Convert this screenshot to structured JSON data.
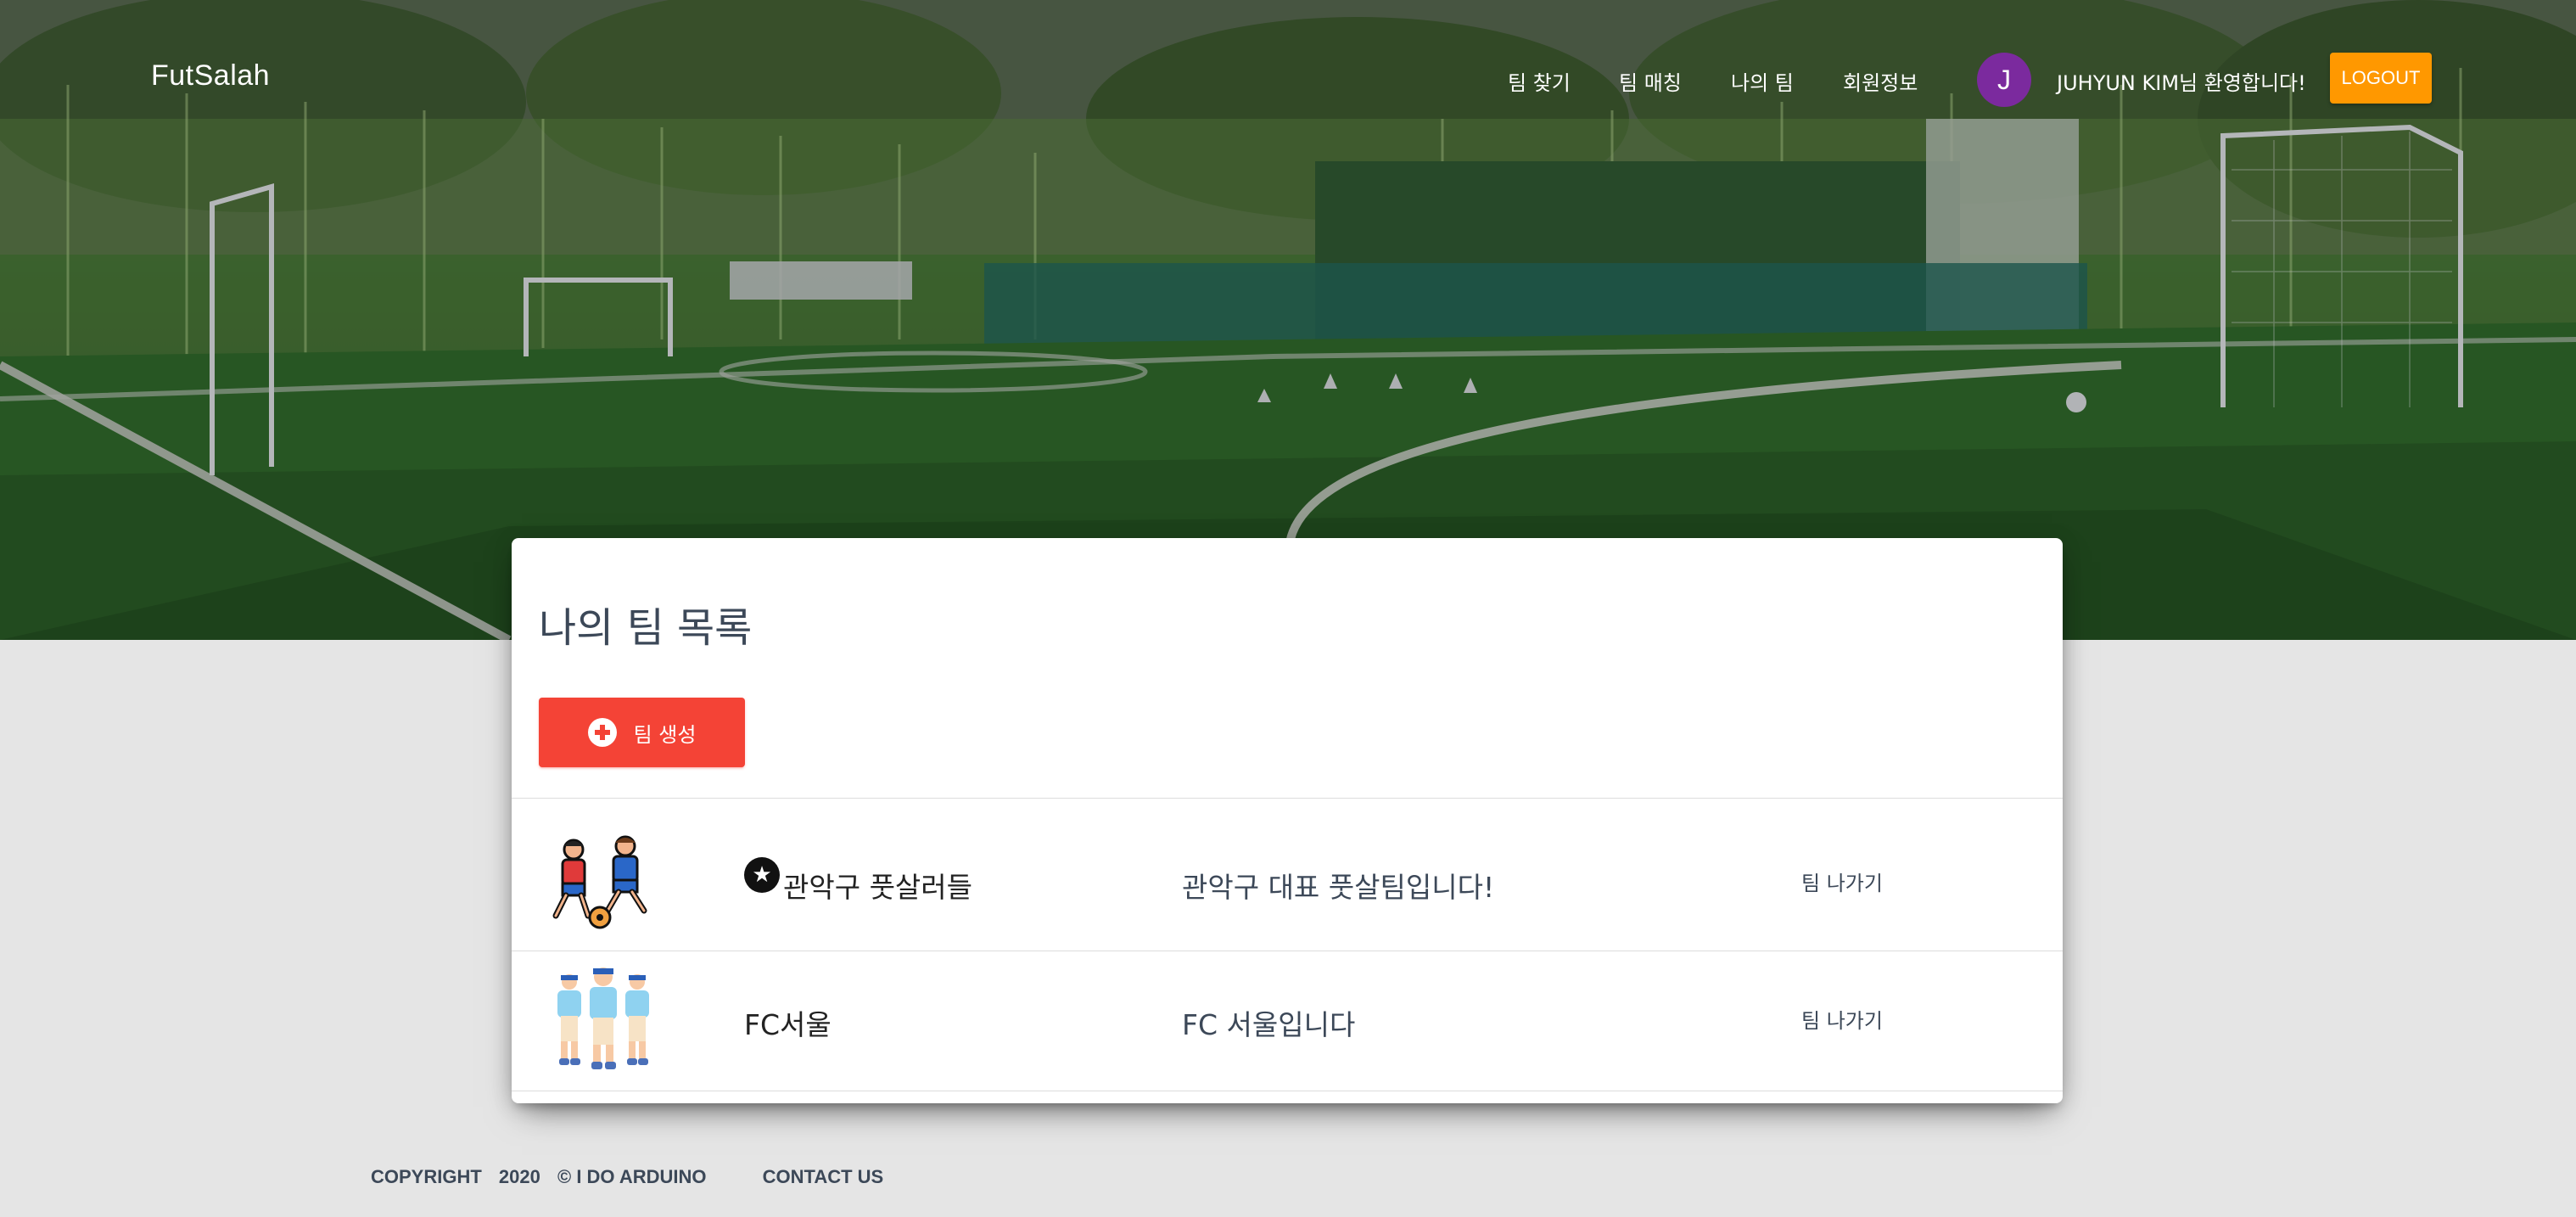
{
  "navbar": {
    "brand": "FutSalah",
    "links": [
      "팀 찾기",
      "팀 매칭",
      "나의 팀",
      "회원정보"
    ],
    "avatar_initial": "J",
    "avatar_color": "#7b2a9e",
    "welcome": "JUHYUN KIM님 환영합니다!",
    "logout": "LOGOUT",
    "logout_color": "#ff9800"
  },
  "card": {
    "title": "나의 팀 목록",
    "create_button": "팀 생성",
    "create_button_color": "#f44336",
    "create_icon": "plus-circle-icon",
    "teams": [
      {
        "name": "관악구 풋살러들",
        "leader_icon": "star-icon",
        "description": "관악구 대표 풋살팀입니다!",
        "leave": "팀 나가기"
      },
      {
        "name": "FC서울",
        "description": "FC 서울입니다",
        "leave": "팀 나가기"
      }
    ]
  },
  "footer": {
    "copyright": "COPYRIGHT",
    "year": "2020",
    "owner": "© I DO ARDUINO",
    "contact": "CONTACT US"
  }
}
